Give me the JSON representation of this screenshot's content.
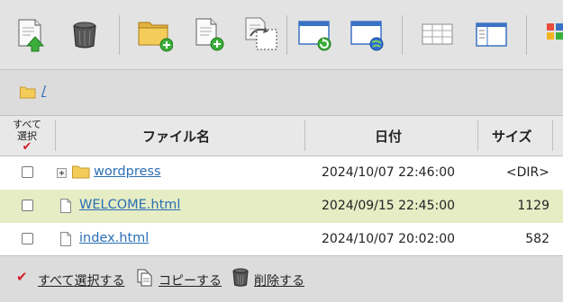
{
  "toolbar": {
    "buttons": [
      {
        "name": "upload-file-icon"
      },
      {
        "name": "trash-icon"
      },
      {
        "name": "new-folder-icon"
      },
      {
        "name": "new-file-icon"
      },
      {
        "name": "move-file-icon"
      },
      {
        "name": "window-refresh-icon"
      },
      {
        "name": "window-globe-icon"
      },
      {
        "name": "list-view-icon"
      },
      {
        "name": "detail-view-icon"
      },
      {
        "name": "grid-view-icon"
      }
    ]
  },
  "breadcrumb": {
    "path": "/"
  },
  "table": {
    "select_all_line1": "すべて",
    "select_all_line2": "選択",
    "check_mark": "✔",
    "columns": {
      "name": "ファイル名",
      "date": "日付",
      "size": "サイズ"
    },
    "rows": [
      {
        "name": "wordpress",
        "date": "2024/10/07 22:46:00",
        "size": "<DIR>",
        "type": "folder",
        "expand": "+",
        "highlight": false
      },
      {
        "name": "WELCOME.html",
        "date": "2024/09/15 22:45:00",
        "size": "1129",
        "type": "file",
        "highlight": true
      },
      {
        "name": "index.html",
        "date": "2024/10/07 20:02:00",
        "size": "582",
        "type": "file",
        "highlight": false
      }
    ]
  },
  "footer": {
    "select_all": "すべて選択する",
    "copy": "コピーする",
    "delete": "削除する",
    "check_mark": "✔"
  },
  "colors": {
    "link": "#2a6fb5",
    "highlight_row": "#e6ecc4",
    "check_red": "#d3202a"
  }
}
